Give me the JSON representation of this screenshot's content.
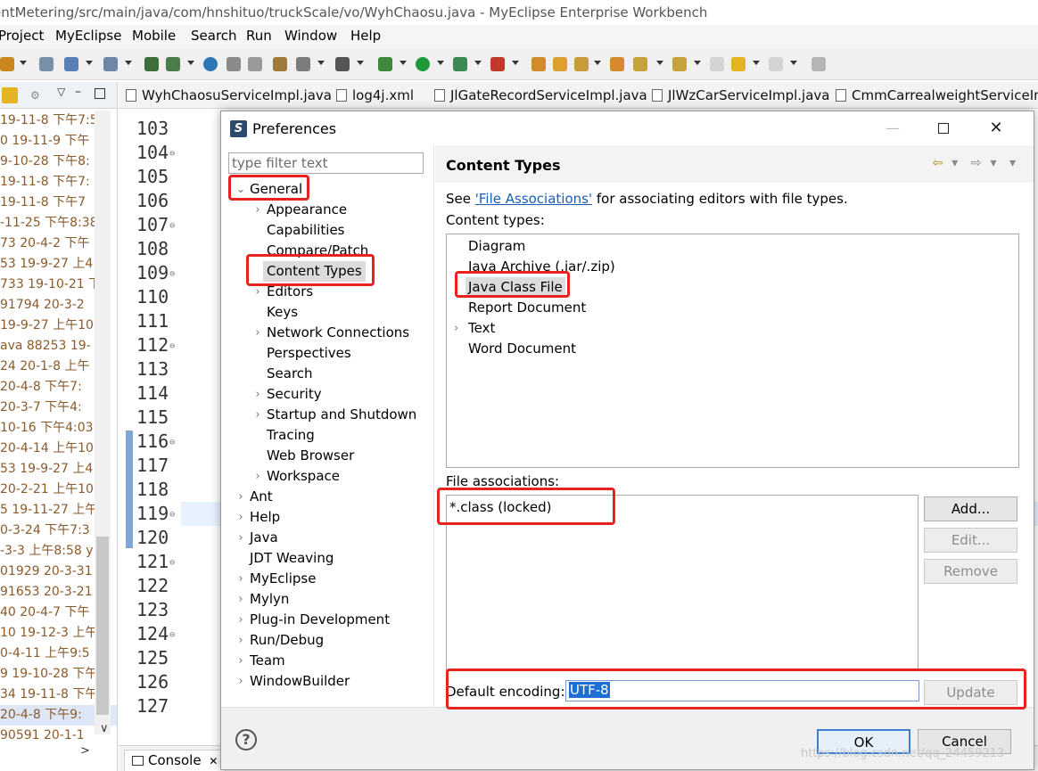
{
  "window": {
    "title": "entMetering/src/main/java/com/hnshituo/truckScale/vo/WyhChaosu.java - MyEclipse Enterprise Workbench"
  },
  "menu": [
    "Project",
    "MyEclipse",
    "Mobile",
    "Search",
    "Run",
    "Window",
    "Help"
  ],
  "left_panel": {
    "rows": [
      "19-11-8 下午7:5",
      "0  19-11-9 下午",
      "9-10-28 下午8:",
      " 19-11-8 下午7:",
      " 19-11-8 下午7",
      "-11-25 下午8:38",
      "73  20-4-2 下午",
      "53  19-9-27 上4",
      "733  19-10-21 下",
      "91794  20-3-2",
      "19-9-27 上午10",
      "ava 88253  19-",
      "24  20-1-8 上午",
      " 20-4-8 下午7:",
      " 20-3-7 下午4:",
      "10-16 下午4:03",
      "20-4-14 上午10",
      "53  19-9-27 上4",
      "20-2-21 上午10",
      "5  19-11-27 上午",
      "0-3-24 下午7:3",
      "-3-3 上午8:58  y",
      "01929  20-3-31",
      "91653  20-3-21",
      "40  20-4-7 下午",
      "10  19-12-3 上午",
      "0-4-11 上午9:5",
      "9  19-10-28 下午",
      "34  19-11-8 下午",
      " 20-4-8 下午9:",
      " 90591  20-1-1"
    ]
  },
  "editor_tabs": [
    "WyhChaosuServiceImpl.java",
    "log4j.xml",
    "JlGateRecordServiceImpl.java",
    "JlWzCarServiceImpl.java",
    "CmmCarrealweightServiceImpl."
  ],
  "line_numbers": [
    "103",
    "104",
    "105",
    "106",
    "107",
    "108",
    "109",
    "110",
    "111",
    "112",
    "113",
    "114",
    "115",
    "116",
    "117",
    "118",
    "119",
    "120",
    "121",
    "122",
    "123",
    "124",
    "125",
    "126",
    "127"
  ],
  "console": {
    "tab": "Console"
  },
  "dialog": {
    "title": "Preferences",
    "filter_placeholder": "type filter text",
    "tree": {
      "general": "General",
      "general_children": [
        "Appearance",
        "Capabilities",
        "Compare/Patch",
        "Content Types",
        "Editors",
        "Keys",
        "Network Connections",
        "Perspectives",
        "Search",
        "Security",
        "Startup and Shutdown",
        "Tracing",
        "Web Browser",
        "Workspace"
      ],
      "top_level": [
        "Ant",
        "Help",
        "Java",
        "JDT Weaving",
        "MyEclipse",
        "Mylyn",
        "Plug-in Development",
        "Run/Debug",
        "Team",
        "WindowBuilder"
      ]
    },
    "page": {
      "heading": "Content Types",
      "see_prefix": "See ",
      "see_link": "'File Associations'",
      "see_suffix": " for associating editors with file types.",
      "content_types_label": "Content types:",
      "content_types": [
        "Diagram",
        "Java Archive (.jar/.zip)",
        "Java Class File",
        "Report Document",
        "Text",
        "Word Document"
      ],
      "file_assoc_label": "File associations:",
      "file_associations": [
        "*.class (locked)"
      ],
      "add": "Add...",
      "edit": "Edit...",
      "remove": "Remove",
      "encoding_label": "Default encoding:",
      "encoding_value": "UTF-8",
      "update": "Update"
    },
    "ok": "OK",
    "cancel": "Cancel"
  },
  "watermark": "https://blog.csdn.net/qq_24459213",
  "colors": {
    "annotation_red": "#e8221f",
    "selection_blue": "#1e6fd2",
    "link_blue": "#1a5fb4"
  }
}
